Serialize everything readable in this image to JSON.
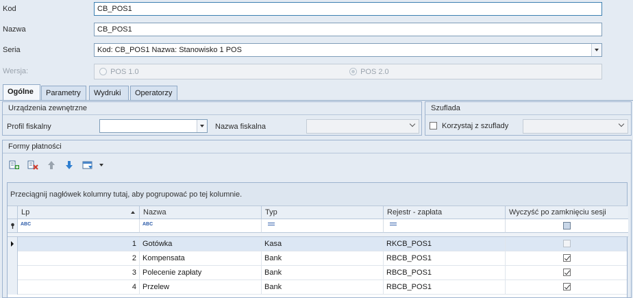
{
  "form": {
    "kod_label": "Kod",
    "kod_value": "CB_POS1",
    "nazwa_label": "Nazwa",
    "nazwa_value": "CB_POS1",
    "seria_label": "Seria",
    "seria_value": "Kod: CB_POS1   Nazwa: Stanowisko 1 POS",
    "wersja_label": "Wersja:",
    "wersja_options": [
      "POS 1.0",
      "POS 2.0"
    ],
    "wersja_selected": "POS 2.0"
  },
  "tabs": [
    "Ogólne",
    "Parametry",
    "Wydruki",
    "Operatorzy"
  ],
  "active_tab": "Ogólne",
  "devices": {
    "title": "Urządzenia zewnętrzne",
    "profil_label": "Profil fiskalny",
    "profil_value": "",
    "nazwa_fiskalna_label": "Nazwa fiskalna",
    "nazwa_fiskalna_value": ""
  },
  "drawer": {
    "title": "Szuflada",
    "checkbox_label": "Korzystaj z szuflady",
    "checked": false
  },
  "payments": {
    "title": "Formy płatności",
    "groupby_hint": "Przeciągnij nagłówek kolumny tutaj, aby pogrupować po tej kolumnie.",
    "columns": [
      "Lp",
      "Nazwa",
      "Typ",
      "Rejestr - zapłata",
      "Wyczyść po zamknięciu sesji"
    ],
    "filter_row": {
      "lp": "ABC",
      "nazwa": "ABC"
    },
    "rows": [
      {
        "lp": "1",
        "nazwa": "Gotówka",
        "typ": "Kasa",
        "rejestr": "RKCB_POS1",
        "wyczysc": false,
        "wyczysc_disabled": true
      },
      {
        "lp": "2",
        "nazwa": "Kompensata",
        "typ": "Bank",
        "rejestr": "RBCB_POS1",
        "wyczysc": true,
        "wyczysc_disabled": false
      },
      {
        "lp": "3",
        "nazwa": "Polecenie zapłaty",
        "typ": "Bank",
        "rejestr": "RBCB_POS1",
        "wyczysc": true,
        "wyczysc_disabled": false
      },
      {
        "lp": "4",
        "nazwa": "Przelew",
        "typ": "Bank",
        "rejestr": "RBCB_POS1",
        "wyczysc": true,
        "wyczysc_disabled": false
      }
    ]
  },
  "colors": {
    "background": "#e4ebf3",
    "accent": "#2b5aa8",
    "selected_row": "#dce7f4"
  }
}
